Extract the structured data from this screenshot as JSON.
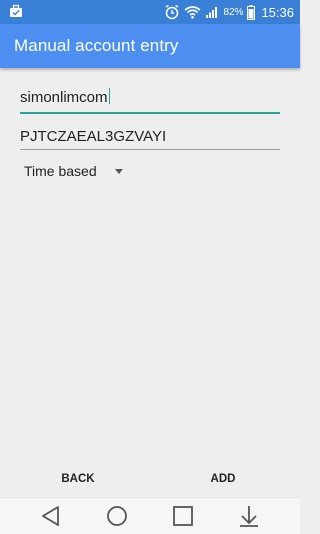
{
  "status_bar": {
    "battery_percent": "82%",
    "time": "15:36",
    "icons": [
      "briefcase-icon",
      "alarm-icon",
      "wifi-icon",
      "signal-icon",
      "battery-icon"
    ]
  },
  "app_bar": {
    "title": "Manual account entry"
  },
  "form": {
    "account_name_value": "simonlimcom",
    "secret_key_value": "PJTCZAEAL3GZVAYI",
    "key_type_selected": "Time based"
  },
  "buttons": {
    "back_label": "BACK",
    "add_label": "ADD"
  },
  "nav_bar": {
    "icons": [
      "back-triangle-icon",
      "home-circle-icon",
      "recent-square-icon",
      "notification-down-icon"
    ]
  },
  "colors": {
    "status_bar": "#3a7fd6",
    "app_bar": "#4c8ff0",
    "accent": "#26a69a",
    "background": "#eeeeee"
  }
}
